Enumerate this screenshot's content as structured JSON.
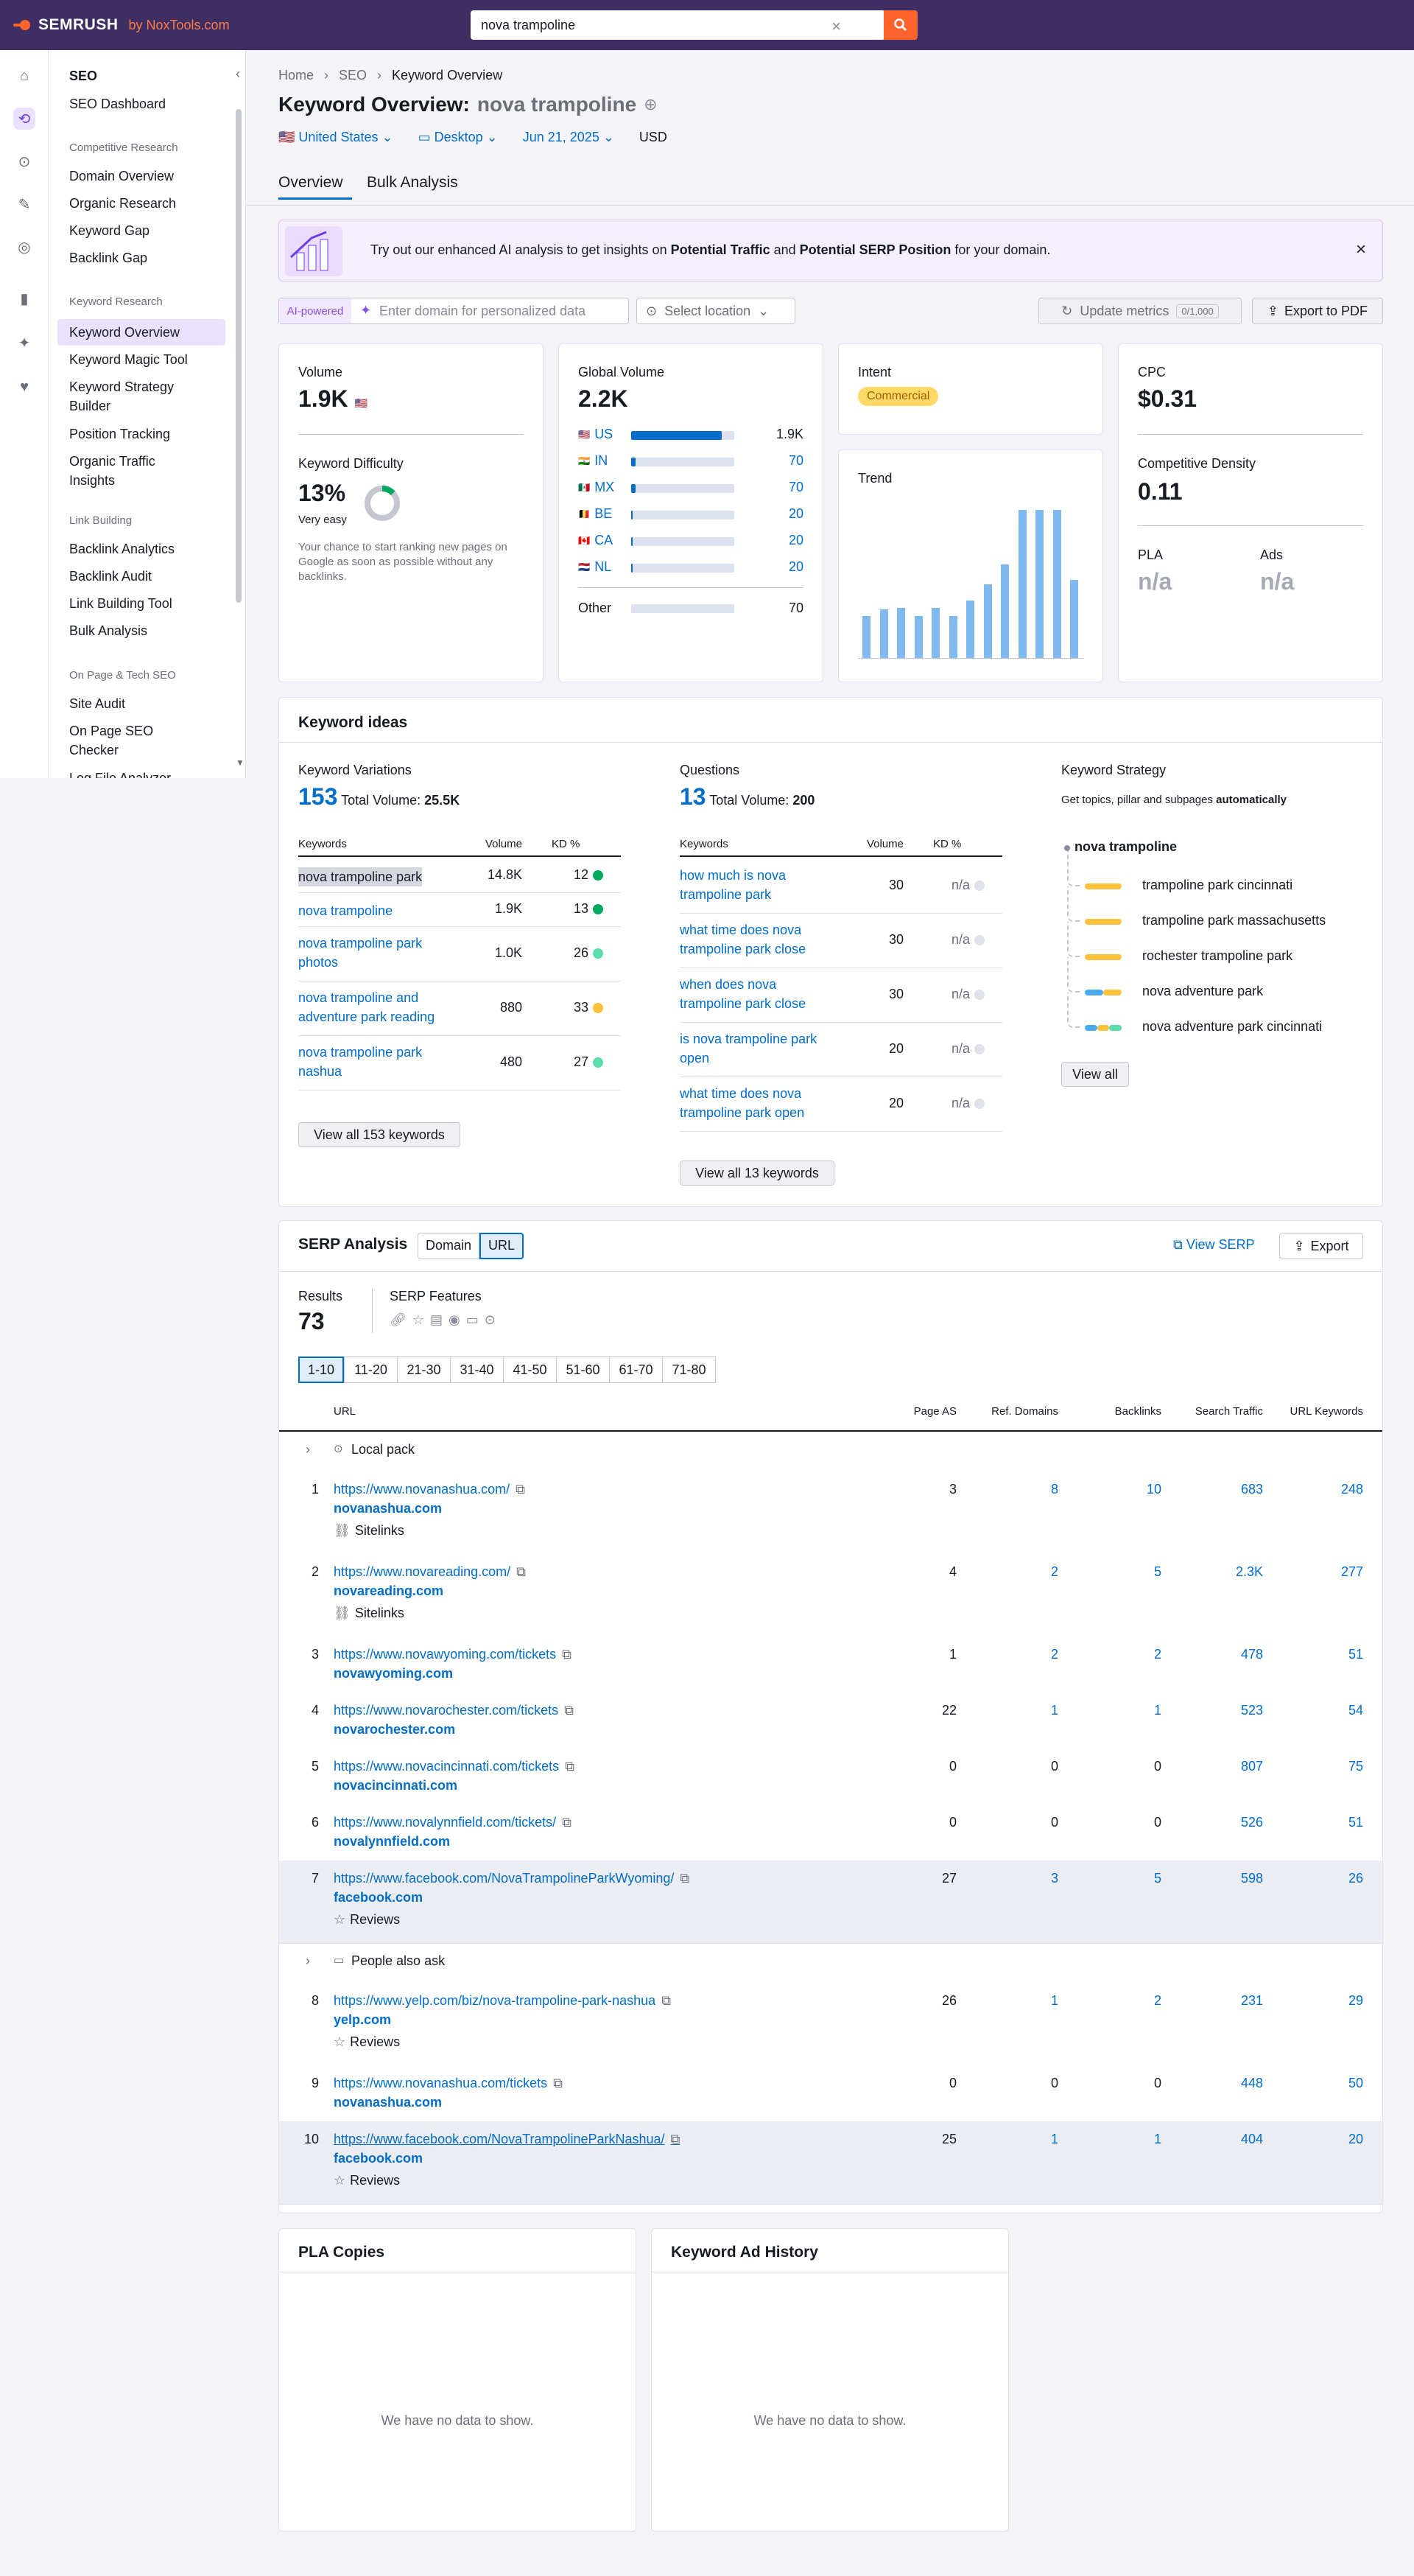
{
  "topbar": {
    "brand": "SEMRUSH",
    "by": "by NoxTools.com",
    "search_value": "nova trampoline"
  },
  "sidebar": {
    "seo_title": "SEO",
    "dashboard": "SEO Dashboard",
    "competitive_head": "Competitive Research",
    "competitive": [
      "Domain Overview",
      "Organic Research",
      "Keyword Gap",
      "Backlink Gap"
    ],
    "keyword_head": "Keyword Research",
    "keyword": [
      "Keyword Overview",
      "Keyword Magic Tool",
      "Keyword Strategy Builder",
      "Position Tracking",
      "Organic Traffic Insights"
    ],
    "link_head": "Link Building",
    "link": [
      "Backlink Analytics",
      "Backlink Audit",
      "Link Building Tool",
      "Bulk Analysis"
    ],
    "onpage_head": "On Page & Tech SEO",
    "onpage": [
      "Site Audit",
      "On Page SEO Checker",
      "Log File Analyzer"
    ]
  },
  "breadcrumb": [
    "Home",
    "SEO",
    "Keyword Overview"
  ],
  "header": {
    "title": "Keyword Overview:",
    "keyword": "nova trampoline",
    "country": "United States",
    "device": "Desktop",
    "date": "Jun 21, 2025",
    "currency": "USD"
  },
  "tabs": [
    "Overview",
    "Bulk Analysis"
  ],
  "banner": {
    "pre": "Try out our enhanced AI analysis to get insights on ",
    "b1": "Potential Traffic",
    "mid": " and ",
    "b2": "Potential SERP Position",
    "post": " for your domain."
  },
  "toolbar": {
    "ai_badge": "AI-powered",
    "domain_placeholder": "Enter domain for personalized data",
    "location": "Select location",
    "update": "Update metrics",
    "update_count": "0/1,000",
    "export": "Export to PDF"
  },
  "volume": {
    "label": "Volume",
    "value": "1.9K",
    "kd_label": "Keyword Difficulty",
    "kd_value": "13%",
    "kd_text": "Very easy",
    "kd_desc": "Your chance to start ranking new pages on Google as soon as possible without any backlinks.",
    "kd_fraction": 0.13
  },
  "global": {
    "label": "Global Volume",
    "value": "2.2K",
    "countries": [
      {
        "code": "US",
        "value": "1.9K",
        "share": 0.88
      },
      {
        "code": "IN",
        "value": "70",
        "share": 0.04
      },
      {
        "code": "MX",
        "value": "70",
        "share": 0.04
      },
      {
        "code": "BE",
        "value": "20",
        "share": 0.01
      },
      {
        "code": "CA",
        "value": "20",
        "share": 0.01
      },
      {
        "code": "NL",
        "value": "20",
        "share": 0.01
      }
    ],
    "other_label": "Other",
    "other_value": "70"
  },
  "intent": {
    "label": "Intent",
    "value": "Commercial"
  },
  "trend": {
    "label": "Trend",
    "values": [
      0.27,
      0.31,
      0.32,
      0.27,
      0.32,
      0.27,
      0.37,
      0.47,
      0.6,
      0.95,
      0.95,
      0.95,
      0.5
    ]
  },
  "cpc": {
    "label": "CPC",
    "value": "$0.31",
    "density_label": "Competitive Density",
    "density_value": "0.11",
    "pla_label": "PLA",
    "pla_value": "n/a",
    "ads_label": "Ads",
    "ads_value": "n/a"
  },
  "ideas": {
    "title": "Keyword ideas",
    "variations": {
      "title": "Keyword Variations",
      "count": "153",
      "total_label": "Total Volume:",
      "total": "25.5K",
      "cols": [
        "Keywords",
        "Volume",
        "KD %"
      ],
      "rows": [
        {
          "kw": "nova trampoline park",
          "vol": "14.8K",
          "kd": "12",
          "color": "#00a95c"
        },
        {
          "kw": "nova trampoline",
          "vol": "1.9K",
          "kd": "13",
          "color": "#00a95c"
        },
        {
          "kw": "nova trampoline park photos",
          "vol": "1.0K",
          "kd": "26",
          "color": "#59ddaa"
        },
        {
          "kw": "nova trampoline and adventure park reading",
          "vol": "880",
          "kd": "33",
          "color": "#fdc23c"
        },
        {
          "kw": "nova trampoline park nashua",
          "vol": "480",
          "kd": "27",
          "color": "#59ddaa"
        }
      ],
      "view_all": "View all 153 keywords"
    },
    "questions": {
      "title": "Questions",
      "count": "13",
      "total_label": "Total Volume:",
      "total": "200",
      "cols": [
        "Keywords",
        "Volume",
        "KD %"
      ],
      "rows": [
        {
          "kw": "how much is nova trampoline park",
          "vol": "30",
          "kd": "n/a"
        },
        {
          "kw": "what time does nova trampoline park close",
          "vol": "30",
          "kd": "n/a"
        },
        {
          "kw": "when does nova trampoline park close",
          "vol": "30",
          "kd": "n/a"
        },
        {
          "kw": "is nova trampoline park open",
          "vol": "20",
          "kd": "n/a"
        },
        {
          "kw": "what time does nova trampoline park open",
          "vol": "20",
          "kd": "n/a"
        }
      ],
      "view_all": "View all 13 keywords"
    },
    "strategy": {
      "title": "Keyword Strategy",
      "desc": "Get topics, pillar and subpages ",
      "desc_b": "automatically",
      "root": "nova trampoline",
      "items": [
        "trampoline park cincinnati",
        "trampoline park massachusetts",
        "rochester trampoline park",
        "nova adventure park",
        "nova adventure park cincinnati"
      ],
      "view_all": "View all"
    }
  },
  "serp": {
    "title": "SERP Analysis",
    "toggle": [
      "Domain",
      "URL"
    ],
    "view_serp": "View SERP",
    "export": "Export",
    "results_label": "Results",
    "results": "73",
    "features_label": "SERP Features",
    "pages": [
      "1-10",
      "11-20",
      "21-30",
      "31-40",
      "41-50",
      "51-60",
      "61-70",
      "71-80"
    ],
    "cols": [
      "URL",
      "Page AS",
      "Ref. Domains",
      "Backlinks",
      "Search Traffic",
      "URL Keywords"
    ],
    "local_pack": "Local pack",
    "people_ask": "People also ask",
    "rows": [
      {
        "n": "1",
        "url": "https://www.novanashua.com/",
        "domain": "novanashua.com",
        "extra": "Sitelinks",
        "as": "3",
        "rd": "8",
        "bl": "10",
        "st": "683",
        "uk": "248"
      },
      {
        "n": "2",
        "url": "https://www.novareading.com/",
        "domain": "novareading.com",
        "extra": "Sitelinks",
        "as": "4",
        "rd": "2",
        "bl": "5",
        "st": "2.3K",
        "uk": "277"
      },
      {
        "n": "3",
        "url": "https://www.novawyoming.com/tickets",
        "domain": "novawyoming.com",
        "extra": "",
        "as": "1",
        "rd": "2",
        "bl": "2",
        "st": "478",
        "uk": "51"
      },
      {
        "n": "4",
        "url": "https://www.novarochester.com/tickets",
        "domain": "novarochester.com",
        "extra": "",
        "as": "22",
        "rd": "1",
        "bl": "1",
        "st": "523",
        "uk": "54"
      },
      {
        "n": "5",
        "url": "https://www.novacincinnati.com/tickets",
        "domain": "novacincinnati.com",
        "extra": "",
        "as": "0",
        "rd": "0",
        "bl": "0",
        "st": "807",
        "uk": "75"
      },
      {
        "n": "6",
        "url": "https://www.novalynnfield.com/tickets/",
        "domain": "novalynnfield.com",
        "extra": "",
        "as": "0",
        "rd": "0",
        "bl": "0",
        "st": "526",
        "uk": "51"
      },
      {
        "n": "7",
        "url": "https://www.facebook.com/NovaTrampolineParkWyoming/",
        "domain": "facebook.com",
        "extra": "Reviews",
        "as": "27",
        "rd": "3",
        "bl": "5",
        "st": "598",
        "uk": "26"
      },
      {
        "n": "8",
        "url": "https://www.yelp.com/biz/nova-trampoline-park-nashua",
        "domain": "yelp.com",
        "extra": "Reviews",
        "as": "26",
        "rd": "1",
        "bl": "2",
        "st": "231",
        "uk": "29"
      },
      {
        "n": "9",
        "url": "https://www.novanashua.com/tickets",
        "domain": "novanashua.com",
        "extra": "",
        "as": "0",
        "rd": "0",
        "bl": "0",
        "st": "448",
        "uk": "50"
      },
      {
        "n": "10",
        "url": "https://www.facebook.com/NovaTrampolineParkNashua/",
        "domain": "facebook.com",
        "extra": "Reviews",
        "as": "25",
        "rd": "1",
        "bl": "1",
        "st": "404",
        "uk": "20"
      }
    ]
  },
  "pla": {
    "title": "PLA Copies",
    "empty": "We have no data to show."
  },
  "adhistory": {
    "title": "Keyword Ad History",
    "empty": "We have no data to show."
  }
}
